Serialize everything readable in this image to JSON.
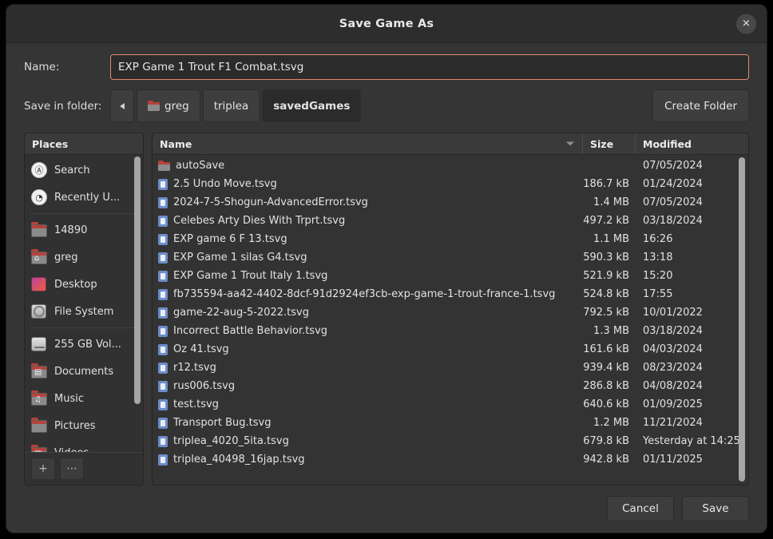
{
  "window": {
    "title": "Save Game As",
    "close_icon": "close-icon"
  },
  "name_field": {
    "label": "Name:",
    "value": "EXP Game 1 Trout F1 Combat.tsvg",
    "placeholder": ""
  },
  "path_bar": {
    "label": "Save in folder:",
    "back_icon": "chevron-left-icon",
    "crumbs": [
      {
        "label": "greg",
        "icon": "home-folder-icon",
        "active": false
      },
      {
        "label": "triplea",
        "icon": "",
        "active": false
      },
      {
        "label": "savedGames",
        "icon": "",
        "active": true
      }
    ],
    "create_folder_label": "Create Folder"
  },
  "sidebar": {
    "header": "Places",
    "items": [
      {
        "label": "Search",
        "icon": "search-icon",
        "type": "circle",
        "glyph": "Ⓐ"
      },
      {
        "label": "Recently U...",
        "icon": "recent-clock-icon",
        "type": "circle",
        "glyph": "◔"
      },
      {
        "separator_after": true,
        "label": "14890",
        "icon": "folder-icon",
        "type": "folder",
        "glyph": ""
      },
      {
        "label": "greg",
        "icon": "home-folder-icon",
        "type": "folder",
        "glyph": "⌂"
      },
      {
        "label": "Desktop",
        "icon": "desktop-icon",
        "type": "desk",
        "glyph": ""
      },
      {
        "label": "File System",
        "icon": "disk-icon",
        "type": "disk",
        "glyph": ""
      },
      {
        "label": "255 GB Vol...",
        "icon": "volume-icon",
        "type": "vol",
        "glyph": ""
      },
      {
        "label": "Documents",
        "icon": "documents-folder-icon",
        "type": "folder",
        "glyph": "▤"
      },
      {
        "label": "Music",
        "icon": "music-folder-icon",
        "type": "folder",
        "glyph": "♫"
      },
      {
        "label": "Pictures",
        "icon": "pictures-folder-icon",
        "type": "folder",
        "glyph": ""
      },
      {
        "label": "Videos",
        "icon": "videos-folder-icon",
        "type": "folder",
        "glyph": "▦"
      }
    ],
    "footer": {
      "add_label": "+",
      "more_label": "⋯"
    }
  },
  "file_list": {
    "columns": {
      "name": "Name",
      "size": "Size",
      "modified": "Modified"
    },
    "sort_icon": "sort-descending-icon",
    "rows": [
      {
        "icon": "folder-icon",
        "name": "autoSave",
        "size": "",
        "modified": "07/05/2024"
      },
      {
        "icon": "file-icon",
        "name": "2.5 Undo Move.tsvg",
        "size": "186.7 kB",
        "modified": "01/24/2024"
      },
      {
        "icon": "file-icon",
        "name": "2024-7-5-Shogun-AdvancedError.tsvg",
        "size": "1.4 MB",
        "modified": "07/05/2024"
      },
      {
        "icon": "file-icon",
        "name": "Celebes Arty Dies With Trprt.tsvg",
        "size": "497.2 kB",
        "modified": "03/18/2024"
      },
      {
        "icon": "file-icon",
        "name": "EXP game 6 F 13.tsvg",
        "size": "1.1 MB",
        "modified": "16:26"
      },
      {
        "icon": "file-icon",
        "name": "EXP Game 1 silas G4.tsvg",
        "size": "590.3 kB",
        "modified": "13:18"
      },
      {
        "icon": "file-icon",
        "name": "EXP Game 1 Trout Italy 1.tsvg",
        "size": "521.9 kB",
        "modified": "15:20"
      },
      {
        "icon": "file-icon",
        "name": "fb735594-aa42-4402-8dcf-91d2924ef3cb-exp-game-1-trout-france-1.tsvg",
        "size": "524.8 kB",
        "modified": "17:55"
      },
      {
        "icon": "file-icon",
        "name": "game-22-aug-5-2022.tsvg",
        "size": "792.5 kB",
        "modified": "10/01/2022"
      },
      {
        "icon": "file-icon",
        "name": "Incorrect Battle Behavior.tsvg",
        "size": "1.3 MB",
        "modified": "03/18/2024"
      },
      {
        "icon": "file-icon",
        "name": "Oz 41.tsvg",
        "size": "161.6 kB",
        "modified": "04/03/2024"
      },
      {
        "icon": "file-icon",
        "name": "r12.tsvg",
        "size": "939.4 kB",
        "modified": "08/23/2024"
      },
      {
        "icon": "file-icon",
        "name": "rus006.tsvg",
        "size": "286.8 kB",
        "modified": "04/08/2024"
      },
      {
        "icon": "file-icon",
        "name": "test.tsvg",
        "size": "640.6 kB",
        "modified": "01/09/2025"
      },
      {
        "icon": "file-icon",
        "name": "Transport Bug.tsvg",
        "size": "1.2 MB",
        "modified": "11/21/2024"
      },
      {
        "icon": "file-icon",
        "name": "triplea_4020_5ita.tsvg",
        "size": "679.8 kB",
        "modified": "Yesterday at 14:25"
      },
      {
        "icon": "file-icon",
        "name": "triplea_40498_16jap.tsvg",
        "size": "942.8 kB",
        "modified": "01/11/2025"
      }
    ]
  },
  "footer": {
    "cancel_label": "Cancel",
    "save_label": "Save"
  },
  "colors": {
    "dialog_bg": "#353535",
    "titlebar_bg": "#2d2d2d",
    "focus_border": "#e18a6e",
    "pane_bg": "#333333",
    "text": "#e2e2e2"
  }
}
